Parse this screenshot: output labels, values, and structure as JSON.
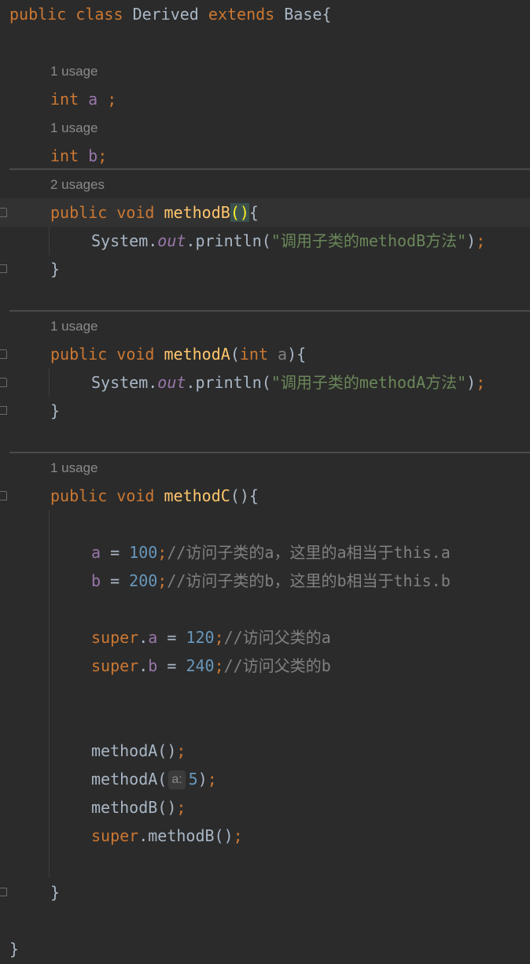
{
  "class_decl": {
    "kw_public": "public",
    "kw_class": "class",
    "name": "Derived",
    "kw_extends": "extends",
    "base": "Base",
    "brace": "{"
  },
  "usage_hints": {
    "field_a": "1 usage",
    "field_b": "1 usage",
    "method_b": "2 usages",
    "method_a": "1 usage",
    "method_c": "1 usage"
  },
  "field_a": {
    "type": "int",
    "name": "a",
    "rest": " ;"
  },
  "field_b": {
    "type": "int",
    "name": "b",
    "semi": ";"
  },
  "method_b": {
    "kw_public": "public",
    "kw_void": "void",
    "name": "methodB",
    "open_paren": "(",
    "close_paren": ")",
    "brace": "{",
    "body": {
      "system": "System.",
      "out": "out",
      "println": ".println(",
      "string": "\"调用子类的methodB方法\"",
      "close": ")",
      "semi": ";"
    },
    "end_brace": "}"
  },
  "method_a": {
    "kw_public": "public",
    "kw_void": "void",
    "name": "methodA",
    "open_paren": "(",
    "param_type": "int",
    "param_name": "a",
    "close": "){",
    "body": {
      "system": "System.",
      "out": "out",
      "println": ".println(",
      "string": "\"调用子类的methodA方法\"",
      "close": ")",
      "semi": ";"
    },
    "end_brace": "}"
  },
  "method_c": {
    "kw_public": "public",
    "kw_void": "void",
    "name": "methodC",
    "paren": "(){",
    "assign_a": {
      "var": "a",
      "op": " = ",
      "value": "100",
      "semi": ";",
      "comment": "//访问子类的a，这里的a相当于this.a"
    },
    "assign_b": {
      "var": "b",
      "op": " = ",
      "value": "200",
      "semi": ";",
      "comment": "//访问子类的b，这里的b相当于this.b"
    },
    "super_a": {
      "kw": "super",
      "dot": ".",
      "var": "a",
      "op": " = ",
      "value": "120",
      "semi": ";",
      "comment": "//访问父类的a"
    },
    "super_b": {
      "kw": "super",
      "dot": ".",
      "var": "b",
      "op": " = ",
      "value": "240",
      "semi": ";",
      "comment": "//访问父类的b"
    },
    "call_1": {
      "text": "methodA()",
      "semi": ";"
    },
    "call_2": {
      "name": "methodA(",
      "inlay_hint": "a:",
      "arg": "5",
      "close": ")",
      "semi": ";"
    },
    "call_3": {
      "text": "methodB()",
      "semi": ";"
    },
    "call_4": {
      "kw": "super",
      "text": ".methodB()",
      "semi": ";"
    },
    "end_brace": "}"
  },
  "class_end": "}"
}
